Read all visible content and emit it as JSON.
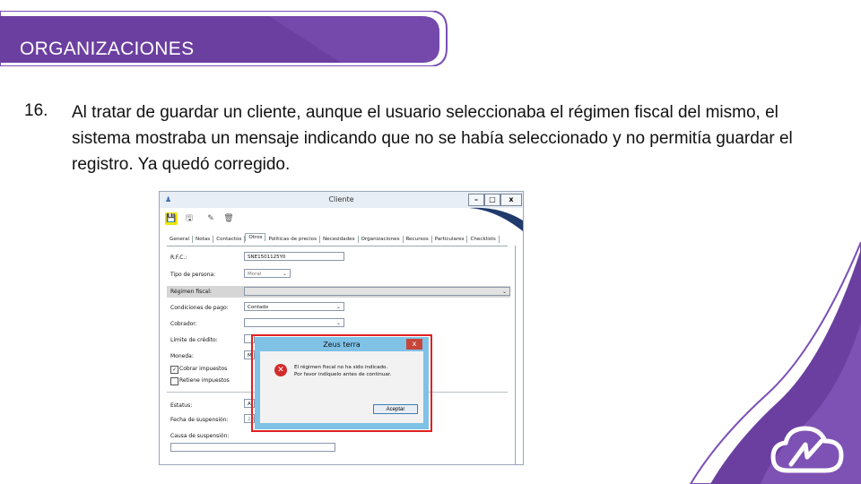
{
  "slide": {
    "title": "ORGANIZACIONES",
    "item_number": "16.",
    "item_text": "Al tratar de guardar un cliente, aunque el usuario seleccionaba el régimen fiscal del mismo, el sistema mostraba un mensaje indicando que no se había seleccionado y no permitía guardar el registro. Ya quedó corregido."
  },
  "colors": {
    "brand_purple": "#6b3fa0",
    "brand_purple_light": "#8e63c4",
    "dialog_frame": "#7fc2e6",
    "highlight_red": "#e02020",
    "save_highlight": "#f2e600"
  },
  "window": {
    "title": "Cliente",
    "minimize": "–",
    "maximize": "□",
    "close": "x"
  },
  "toolbar": {
    "icons": [
      "save-icon",
      "save-close-icon",
      "edit-icon",
      "delete-icon"
    ]
  },
  "tabs": [
    "General",
    "Notas",
    "Contactos",
    "Otros",
    "Políticas de precios",
    "Necesidades",
    "Organizaciones",
    "Recursos",
    "Particulares",
    "Checklists"
  ],
  "active_tab": "Otros",
  "form": {
    "rfc_label": "R.F.C.:",
    "rfc_value": "SNE1501125Y0",
    "tipo_label": "Tipo de persona:",
    "tipo_value": "Moral",
    "regimen_label": "Régimen fiscal:",
    "regimen_value": "",
    "condiciones_label": "Condiciones de pago:",
    "condiciones_value": "Contado",
    "cobrador_label": "Cobrador:",
    "cobrador_value": "",
    "limite_label": "Límite de crédito:",
    "moneda_label": "Moneda:",
    "moneda_value": "M",
    "cobrar_label": "Cobrar impuestos",
    "cobrar_checked": true,
    "retiene_label": "Retiene impuestos",
    "retiene_checked": false,
    "estatus_label": "Estatus:",
    "estatus_value": "A",
    "fecha_label": "Fecha de suspensión:",
    "fecha_value": "28",
    "causa_label": "Causa de suspensión:"
  },
  "dialog": {
    "title": "Zeus terra",
    "close": "x",
    "line1": "El régimen fiscal no ha sido indicado.",
    "line2": "Por favor indíquelo antes de continuar.",
    "button": "Aceptar"
  }
}
